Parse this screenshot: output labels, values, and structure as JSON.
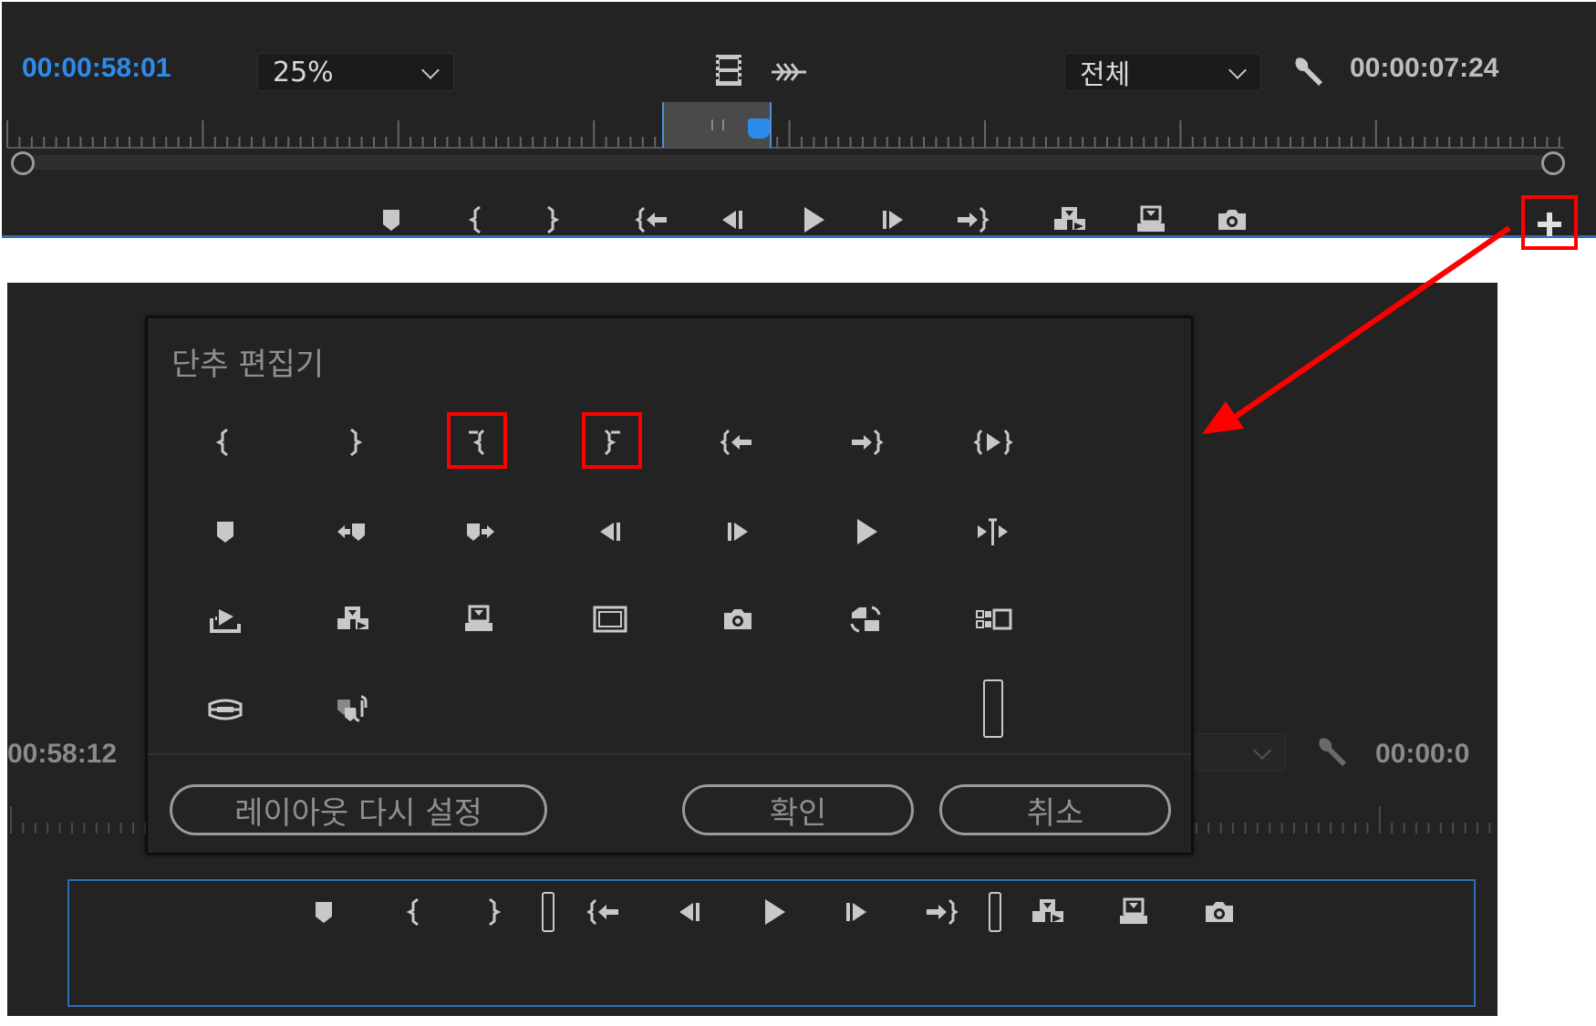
{
  "top_monitor": {
    "timecode_left": "00:00:58:01",
    "zoom_value": "25%",
    "quality_value": "전체",
    "timecode_right": "00:00:07:24",
    "icons": [
      "export-frame-toggle-icon",
      "audio-waveform-icon",
      "wrench-icon"
    ],
    "transport": [
      "add-marker-icon",
      "mark-in-icon",
      "mark-out-icon",
      "go-to-in-icon",
      "step-back-icon",
      "play-icon",
      "step-forward-icon",
      "go-to-out-icon",
      "insert-icon",
      "overwrite-icon",
      "export-frame-icon"
    ],
    "plus_button": "button-editor-plus-icon",
    "accent_color": "#2d8ceb"
  },
  "bottom_monitor": {
    "timecode_left": "00:58:12",
    "timecode_right": "00:00:0",
    "transport": [
      "add-marker-icon",
      "mark-in-icon",
      "mark-out-icon",
      "spacer-icon",
      "go-to-in-icon",
      "step-back-icon",
      "play-icon",
      "step-forward-icon",
      "go-to-out-icon",
      "spacer-icon",
      "insert-icon",
      "overwrite-icon",
      "export-frame-icon"
    ]
  },
  "dialog": {
    "title": "단추 편집기",
    "reset_label": "레이아웃 다시 설정",
    "ok_label": "확인",
    "cancel_label": "취소",
    "highlight_color": "#ff0000"
  }
}
